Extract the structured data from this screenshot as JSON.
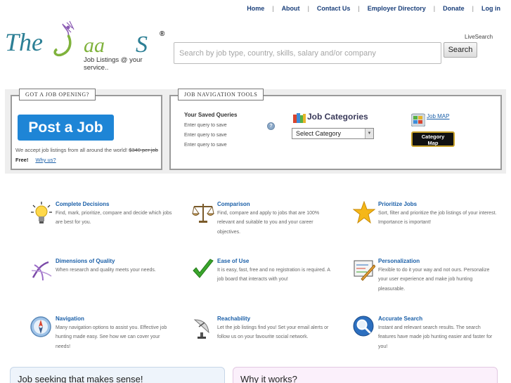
{
  "nav": {
    "home": "Home",
    "about": "About",
    "contact": "Contact Us",
    "employer": "Employer Directory",
    "donate": "Donate",
    "login": "Log in",
    "separator": "|"
  },
  "logo": {
    "wordmark": "TheJaaS",
    "reg": "®",
    "tagline": "Job Listings @ your service.."
  },
  "search": {
    "livesearch": "LiveSearch",
    "placeholder": "Search by job type, country, skills, salary and/or company",
    "button": "Search"
  },
  "panel_post": {
    "title": "GOT A JOB OPENING?",
    "button": "Post a Job",
    "note": "We accept job listings from all around the world!",
    "price": "$340 per job",
    "free": "Free!",
    "why": "Why us?"
  },
  "panel_tools": {
    "title": "JOB NAVIGATION TOOLS",
    "saved_title": "Your Saved Queries",
    "saved_items": [
      "Enter query to save",
      "Enter query to save",
      "Enter query to save"
    ],
    "categories_title": "Job Categories",
    "select_value": "Select Category",
    "map_link": "Job MAP",
    "map_button_line1": "Category",
    "map_button_line2": "Map"
  },
  "features": [
    {
      "icon": "lightbulb-icon",
      "title": "Complete Decisions",
      "desc": "Find, mark, prioritize, compare and decide which jobs are best for you."
    },
    {
      "icon": "scales-icon",
      "title": "Comparison",
      "desc": "Find, compare and apply to jobs that are 100% relevant and suitable to you and your career objectives."
    },
    {
      "icon": "star-icon",
      "title": "Prioritize Jobs",
      "desc": "Sort, filter and prioritize the job listings of your interest. Importance is important!"
    },
    {
      "icon": "dimensions-icon",
      "title": "Dimensions of Quality",
      "desc": "When research and quality meets your needs."
    },
    {
      "icon": "checkmark-icon",
      "title": "Ease of Use",
      "desc": "It is easy, fast, free and no registration is required. A job board that interacts with you!"
    },
    {
      "icon": "pencil-board-icon",
      "title": "Personalization",
      "desc": "Flexible to do it your way and not ours. Personalize your user experience and make job hunting pleasurable."
    },
    {
      "icon": "compass-icon",
      "title": "Navigation",
      "desc": "Many navigation options to assist you. Effective job hunting made easy. See how we can cover your needs!"
    },
    {
      "icon": "satellite-dish-icon",
      "title": "Reachability",
      "desc": "Let the job listings find you! Set your email alerts or follow us on your favourite social network."
    },
    {
      "icon": "magnifier-icon",
      "title": "Accurate Search",
      "desc": "Instant and relevant search results. The search features have made job hunting easier and faster for you!"
    }
  ],
  "bottom": {
    "left_title": "Job seeking that makes sense!",
    "right_title": "Why it works?"
  },
  "colors": {
    "accent_blue": "#1e85d6",
    "link_blue": "#1a5fa8",
    "logo_green": "#7fb23c",
    "logo_teal": "#2c7f95",
    "logo_purple": "#8b5bb3"
  }
}
